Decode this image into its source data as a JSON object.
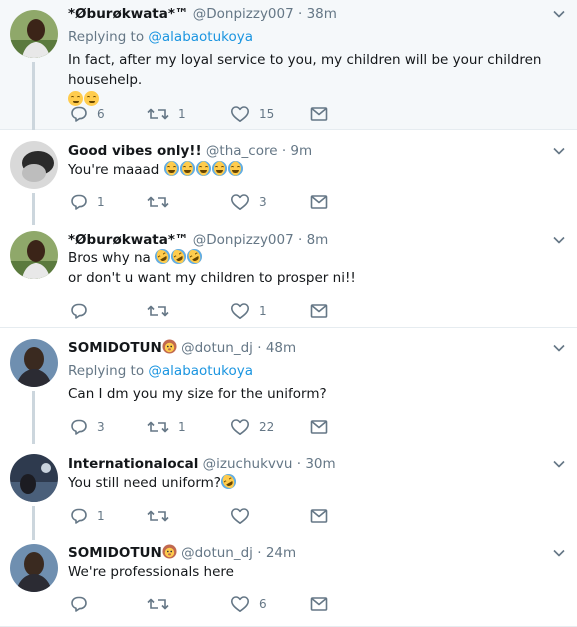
{
  "tweets": [
    {
      "name": "*Øburøkwata*™",
      "handle": "@Donpizzy007",
      "time": "38m",
      "replying_label": "Replying to",
      "replying_to": "@alabaotukoya",
      "text": "In fact, after my loyal service to you, my children will be your children househelp.",
      "emojis": [
        "relieved-face",
        "relieved-face"
      ],
      "replies": "6",
      "retweets": "1",
      "likes": "15"
    },
    {
      "name": "Good vibes only!!",
      "handle": "@tha_core",
      "time": "9m",
      "text": "You're maaad",
      "emojis": [
        "face-with-tears-of-joy",
        "face-with-tears-of-joy",
        "face-with-tears-of-joy",
        "face-with-tears-of-joy",
        "face-with-tears-of-joy"
      ],
      "replies": "1",
      "retweets": "",
      "likes": "3"
    },
    {
      "name": "*Øburøkwata*™",
      "handle": "@Donpizzy007",
      "time": "8m",
      "text_line1": "Bros why na",
      "text_line2": "or don't u want my children to prosper ni!!",
      "emojis": [
        "rolling-on-floor-laughing",
        "rolling-on-floor-laughing",
        "rolling-on-floor-laughing"
      ],
      "replies": "",
      "retweets": "",
      "likes": "1"
    },
    {
      "name": "SOMIDOTUN",
      "handle": "@dotun_dj",
      "time": "48m",
      "replying_label": "Replying to",
      "replying_to": "@alabaotukoya",
      "text": "Can I dm you my size for the uniform?",
      "replies": "3",
      "retweets": "1",
      "likes": "22"
    },
    {
      "name": "Internationalocal",
      "handle": "@izuchukvvu",
      "time": "30m",
      "text": "You still need uniform?",
      "emojis": [
        "rolling-on-floor-laughing"
      ],
      "replies": "1",
      "retweets": "",
      "likes": ""
    },
    {
      "name": "SOMIDOTUN",
      "handle": "@dotun_dj",
      "time": "24m",
      "text": "We're professionals here",
      "replies": "",
      "retweets": "",
      "likes": "6"
    }
  ],
  "separator": "·",
  "colors": {
    "text": "#14171a",
    "secondary": "#657786",
    "link": "#1b95e0",
    "border": "#e6ecf0",
    "thread_line": "#ccd6dd",
    "highlight_bg": "#f5f8fa"
  },
  "icons": [
    "reply-icon",
    "retweet-icon",
    "like-icon",
    "message-icon",
    "chevron-down-icon",
    "lion-face-icon"
  ]
}
